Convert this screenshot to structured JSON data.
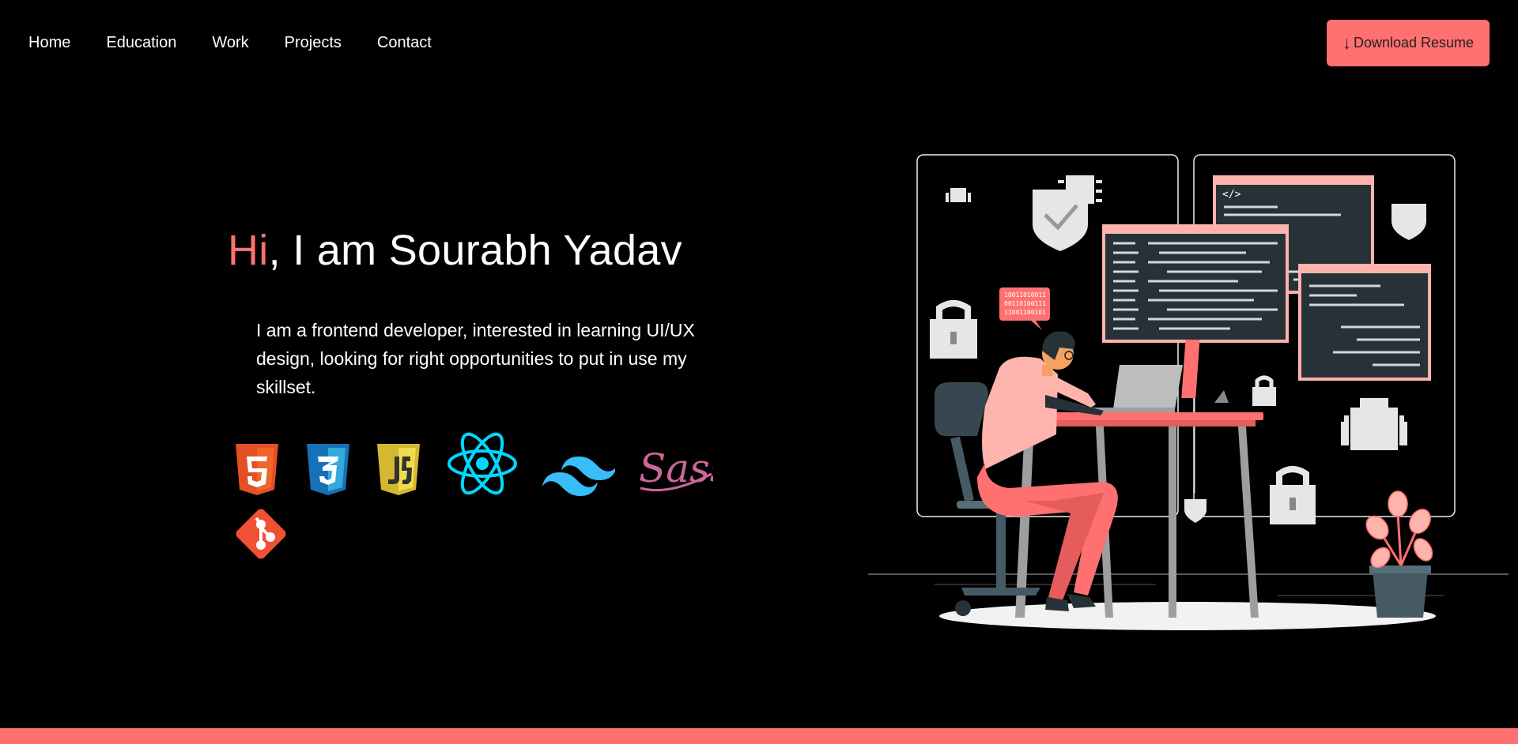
{
  "nav": {
    "links": [
      "Home",
      "Education",
      "Work",
      "Projects",
      "Contact"
    ],
    "resume_button": {
      "icon": "arrow-down-icon",
      "arrow": "↓",
      "label": "Download Resume"
    }
  },
  "hero": {
    "greeting": "Hi",
    "title_rest": ", I am Sourabh Yadav",
    "description": "I am a frontend developer, interested in learning UI/UX design, looking for right opportunities to put in use my skillset."
  },
  "skills": [
    {
      "name": "html5-icon",
      "color": "#e34f26"
    },
    {
      "name": "css3-icon",
      "color": "#1572b6"
    },
    {
      "name": "javascript-icon",
      "color": "#f0db4f"
    },
    {
      "name": "react-icon",
      "color": "#00d8ff"
    },
    {
      "name": "tailwind-icon",
      "color": "#38bdf8"
    },
    {
      "name": "sass-icon",
      "color": "#cd6799"
    },
    {
      "name": "git-icon",
      "color": "#f05033"
    }
  ],
  "illustration": {
    "name": "developer-at-desk-illustration",
    "binary_bubble": [
      "10011010011",
      "00110100111",
      "11001100101"
    ],
    "code_tag": "</>"
  },
  "colors": {
    "accent": "#ff7070",
    "background": "#000000"
  }
}
